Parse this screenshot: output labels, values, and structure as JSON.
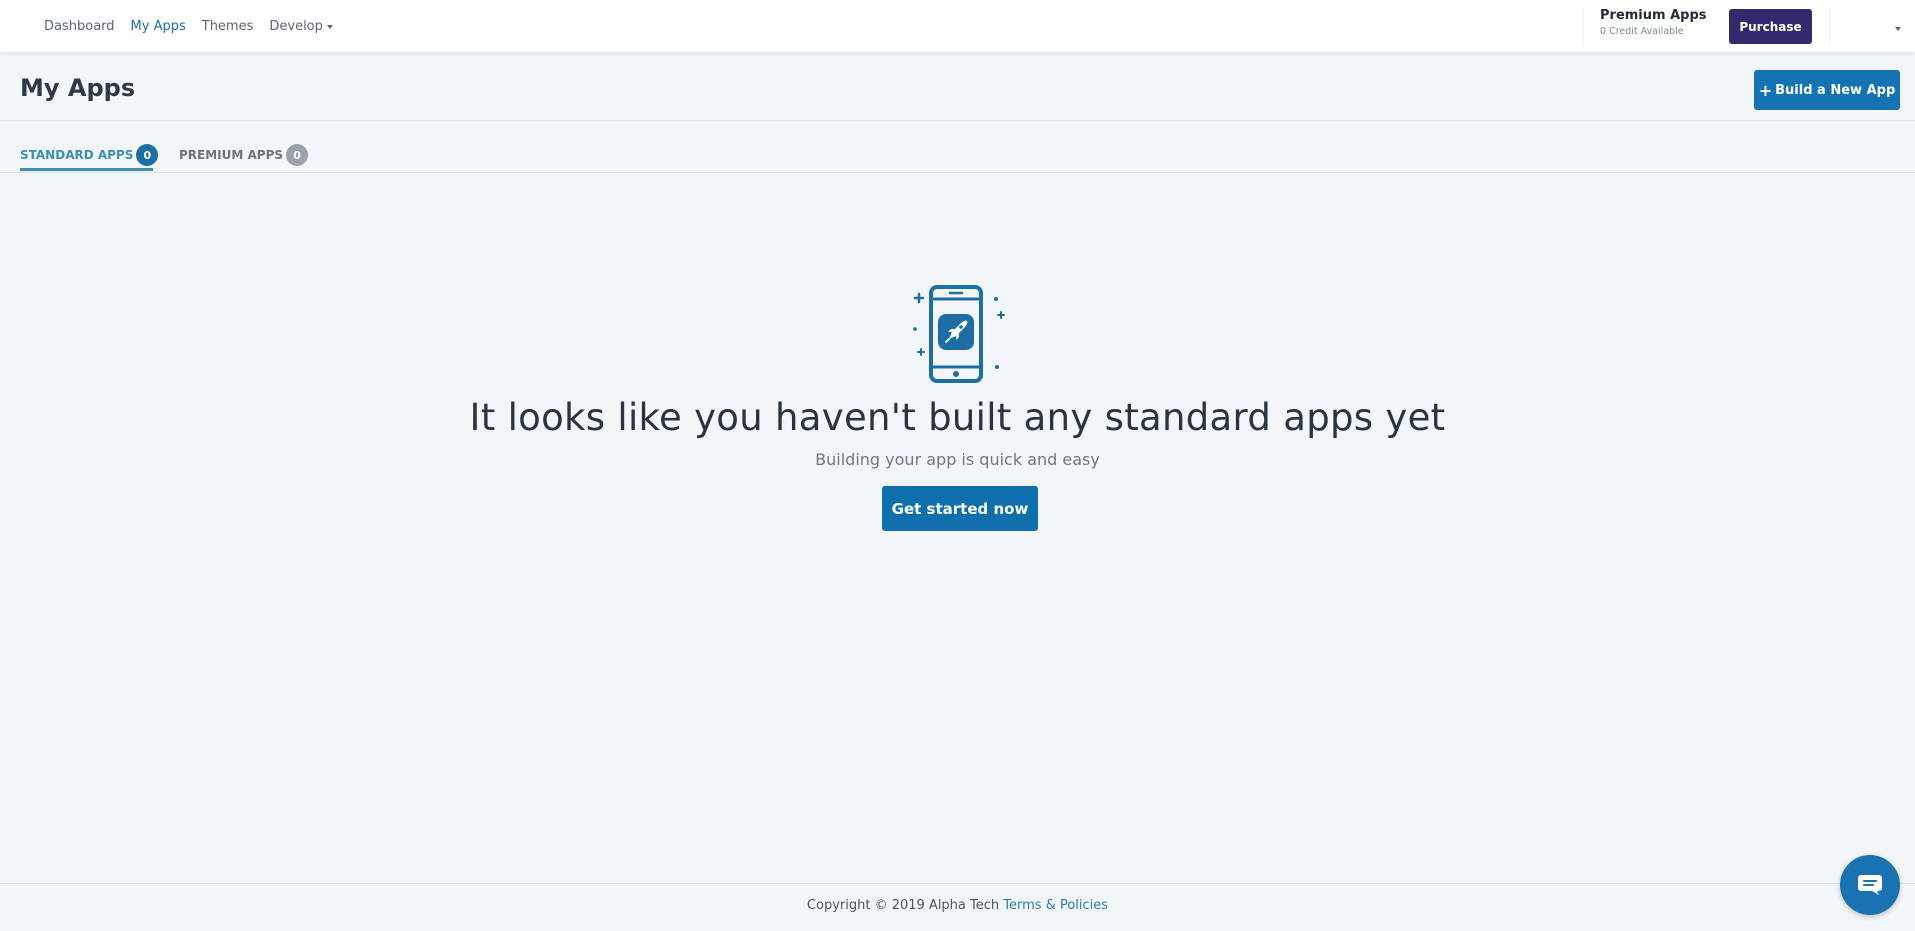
{
  "nav": {
    "items": [
      {
        "label": "Dashboard",
        "active": false
      },
      {
        "label": "My Apps",
        "active": true
      },
      {
        "label": "Themes",
        "active": false
      },
      {
        "label": "Develop",
        "active": false,
        "dropdown": true
      }
    ]
  },
  "credits": {
    "title": "Premium Apps",
    "subtitle": "0 Credit Available"
  },
  "purchase_label": "Purchase",
  "page": {
    "title": "My Apps",
    "build_label": "Build a New App"
  },
  "tabs": [
    {
      "label": "STANDARD APPS",
      "count": "0",
      "active": true
    },
    {
      "label": "PREMIUM APPS",
      "count": "0",
      "active": false
    }
  ],
  "empty_state": {
    "icon": "phone-rocket-icon",
    "headline": "It looks like you haven't built any standard apps yet",
    "subline": "Building your app is quick and easy",
    "cta": "Get started now"
  },
  "footer": {
    "copyright": "Copyright © 2019 Alpha Tech",
    "link": "Terms & Policies"
  },
  "colors": {
    "primary": "#1573b4",
    "purchase": "#34296c",
    "background": "#f3f6f9"
  }
}
